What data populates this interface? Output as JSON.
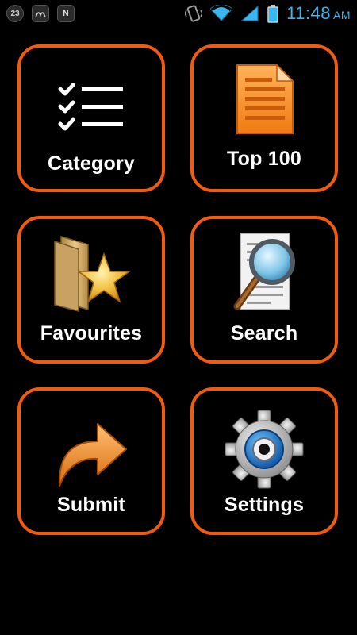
{
  "status_bar": {
    "notif_1": "23",
    "notif_3": "N",
    "time": "11:48",
    "ampm": "AM"
  },
  "menu": [
    {
      "label": "Category",
      "icon": "checklist-icon"
    },
    {
      "label": "Top 100",
      "icon": "document-icon"
    },
    {
      "label": "Favourites",
      "icon": "folder-star-icon"
    },
    {
      "label": "Search",
      "icon": "magnifier-document-icon"
    },
    {
      "label": "Submit",
      "icon": "forward-arrow-icon"
    },
    {
      "label": "Settings",
      "icon": "gear-icon"
    }
  ],
  "colors": {
    "tile_border": "#f25a10",
    "clock": "#39b7f0"
  }
}
